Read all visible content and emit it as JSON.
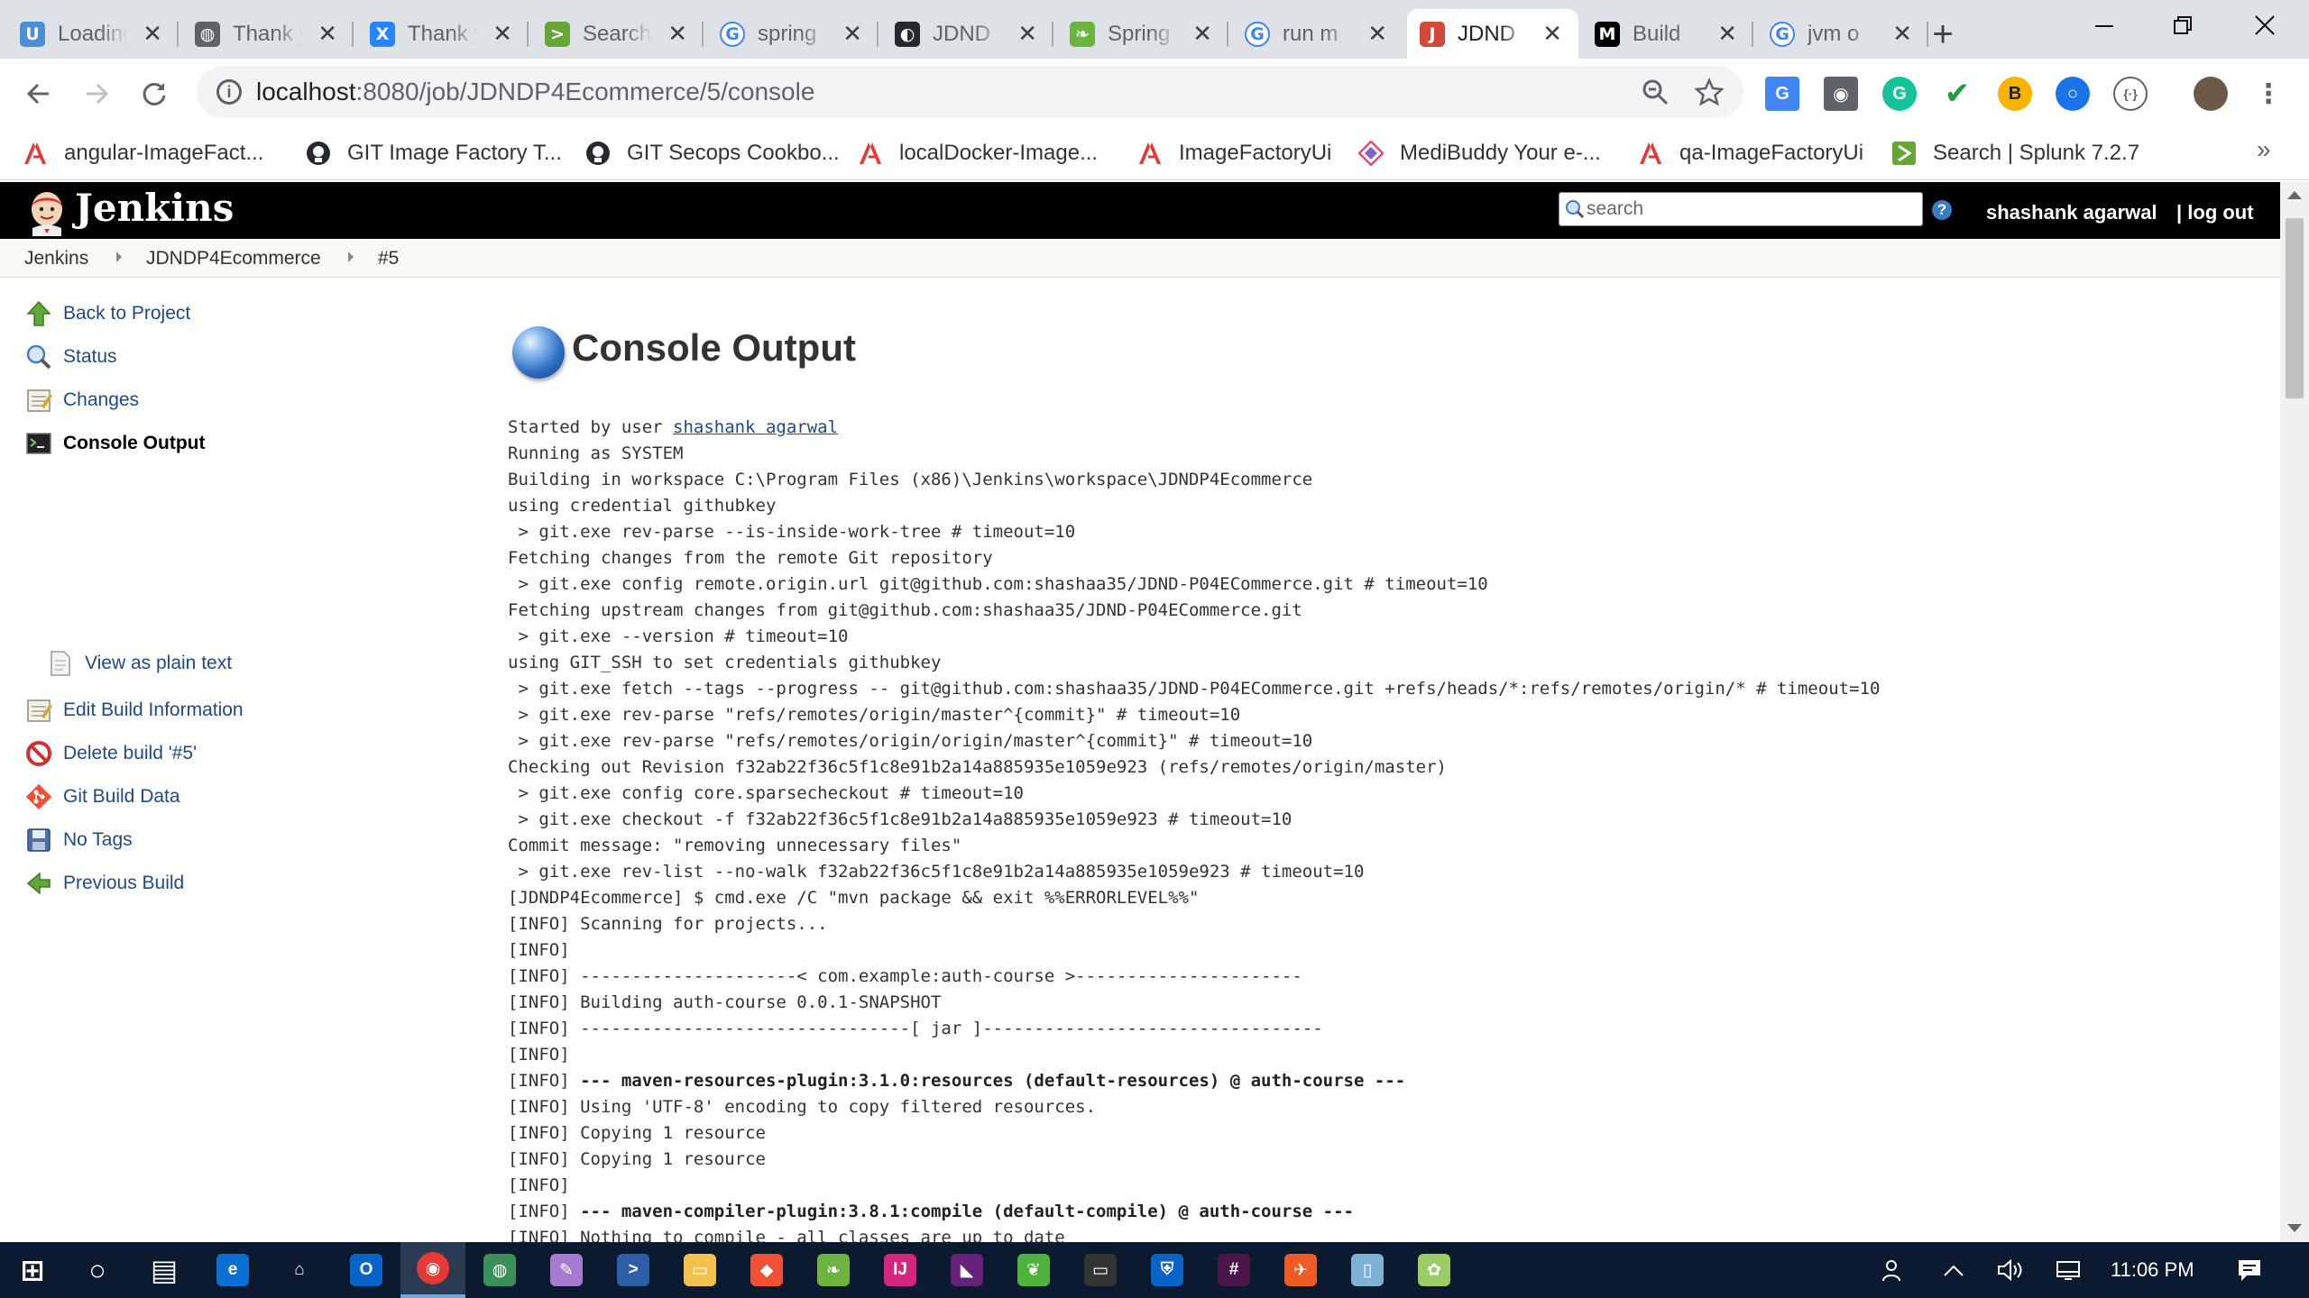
{
  "browser": {
    "tabs": [
      {
        "title": "Loading...",
        "icon": "uservoice-icon",
        "color": "#4a90d9"
      },
      {
        "title": "Thank you",
        "icon": "globe-icon",
        "color": "#5f6368"
      },
      {
        "title": "Thank you",
        "icon": "confluence-icon",
        "color": "#2684ff"
      },
      {
        "title": "Search",
        "icon": "splunk-icon",
        "color": "#65a637"
      },
      {
        "title": "spring",
        "icon": "google-icon",
        "color": "#4285f4"
      },
      {
        "title": "JDND",
        "icon": "github-icon",
        "color": "#24292e"
      },
      {
        "title": "Spring",
        "icon": "spring-leaf-icon",
        "color": "#6db33f"
      },
      {
        "title": "run m",
        "icon": "google-icon",
        "color": "#4285f4"
      },
      {
        "title": "JDND",
        "icon": "jenkins-icon",
        "color": "#d24939"
      },
      {
        "title": "Build",
        "icon": "medium-icon",
        "color": "#000000"
      },
      {
        "title": "jvm o",
        "icon": "google-icon",
        "color": "#4285f4"
      }
    ],
    "active_tab_index": 8,
    "new_tab_label": "+",
    "url_host": "localhost",
    "url_path": ":8080/job/JDNDP4Ecommerce/5/console",
    "bookmarks": [
      {
        "label": "angular-ImageFact...",
        "icon": "adobe-icon"
      },
      {
        "label": "GIT Image Factory T...",
        "icon": "github-icon"
      },
      {
        "label": "GIT Secops Cookbo...",
        "icon": "github-icon"
      },
      {
        "label": "localDocker-Image...",
        "icon": "adobe-icon"
      },
      {
        "label": "ImageFactoryUi",
        "icon": "adobe-icon"
      },
      {
        "label": "MediBuddy Your e-...",
        "icon": "medibuddy-icon"
      },
      {
        "label": "qa-ImageFactoryUi",
        "icon": "adobe-icon"
      },
      {
        "label": "Search | Splunk 7.2.7",
        "icon": "splunk-icon"
      }
    ],
    "bookmarks_more": "»"
  },
  "jenkins": {
    "brand": "Jenkins",
    "search_placeholder": "search",
    "help": "?",
    "user": "shashank agarwal",
    "logout": "| log out",
    "breadcrumbs": [
      "Jenkins",
      "JDNDP4Ecommerce",
      "#5"
    ],
    "sidebar": [
      {
        "label": "Back to Project",
        "icon": "up-arrow-icon"
      },
      {
        "label": "Status",
        "icon": "magnifier-icon"
      },
      {
        "label": "Changes",
        "icon": "notepad-icon"
      },
      {
        "label": "Console Output",
        "icon": "terminal-icon"
      },
      {
        "label": "View as plain text",
        "icon": "document-icon"
      },
      {
        "label": "Edit Build Information",
        "icon": "notepad-icon"
      },
      {
        "label": "Delete build '#5'",
        "icon": "no-entry-icon"
      },
      {
        "label": "Git Build Data",
        "icon": "git-icon"
      },
      {
        "label": "No Tags",
        "icon": "save-disk-icon"
      },
      {
        "label": "Previous Build",
        "icon": "left-arrow-icon"
      }
    ],
    "heading": "Console Output",
    "console": {
      "started_prefix": "Started by user ",
      "started_user": "shashank agarwal",
      "lines": [
        "Running as SYSTEM",
        "Building in workspace C:\\Program Files (x86)\\Jenkins\\workspace\\JDNDP4Ecommerce",
        "using credential githubkey",
        " > git.exe rev-parse --is-inside-work-tree # timeout=10",
        "Fetching changes from the remote Git repository",
        " > git.exe config remote.origin.url git@github.com:shashaa35/JDND-P04ECommerce.git # timeout=10",
        "Fetching upstream changes from git@github.com:shashaa35/JDND-P04ECommerce.git",
        " > git.exe --version # timeout=10",
        "using GIT_SSH to set credentials githubkey",
        " > git.exe fetch --tags --progress -- git@github.com:shashaa35/JDND-P04ECommerce.git +refs/heads/*:refs/remotes/origin/* # timeout=10",
        " > git.exe rev-parse \"refs/remotes/origin/master^{commit}\" # timeout=10",
        " > git.exe rev-parse \"refs/remotes/origin/origin/master^{commit}\" # timeout=10",
        "Checking out Revision f32ab22f36c5f1c8e91b2a14a885935e1059e923 (refs/remotes/origin/master)",
        " > git.exe config core.sparsecheckout # timeout=10",
        " > git.exe checkout -f f32ab22f36c5f1c8e91b2a14a885935e1059e923 # timeout=10",
        "Commit message: \"removing unnecessary files\"",
        " > git.exe rev-list --no-walk f32ab22f36c5f1c8e91b2a14a885935e1059e923 # timeout=10",
        "[JDNDP4Ecommerce] $ cmd.exe /C \"mvn package && exit %%ERRORLEVEL%%\"",
        "[INFO] Scanning for projects...",
        "[INFO]",
        "[INFO] ---------------------< com.example:auth-course >----------------------",
        "[INFO] Building auth-course 0.0.1-SNAPSHOT",
        "[INFO] --------------------------------[ jar ]---------------------------------",
        "[INFO]",
        "[INFO] --- maven-resources-plugin:3.1.0:resources (default-resources) @ auth-course ---",
        "[INFO] Using 'UTF-8' encoding to copy filtered resources.",
        "[INFO] Copying 1 resource",
        "[INFO] Copying 1 resource",
        "[INFO]",
        "[INFO] --- maven-compiler-plugin:3.8.1:compile (default-compile) @ auth-course ---",
        "[INFO] Nothing to compile - all classes are up to date"
      ]
    }
  },
  "taskbar": {
    "apps": [
      "start-icon",
      "cortana-icon",
      "task-view-icon",
      "edge-icon",
      "store-icon",
      "outlook-icon",
      "chrome-icon",
      "world-icon",
      "paint-icon",
      "powershell-icon",
      "file-explorer-icon",
      "git-icon",
      "spring-tools-icon",
      "intellij-icon",
      "visual-studio-icon",
      "mongodb-icon",
      "terminal-icon",
      "defender-icon",
      "slack-icon",
      "postman-icon",
      "notepad-icon",
      "paint-brush-icon"
    ],
    "active_app": "chrome-icon",
    "clock": "11:06 PM"
  }
}
